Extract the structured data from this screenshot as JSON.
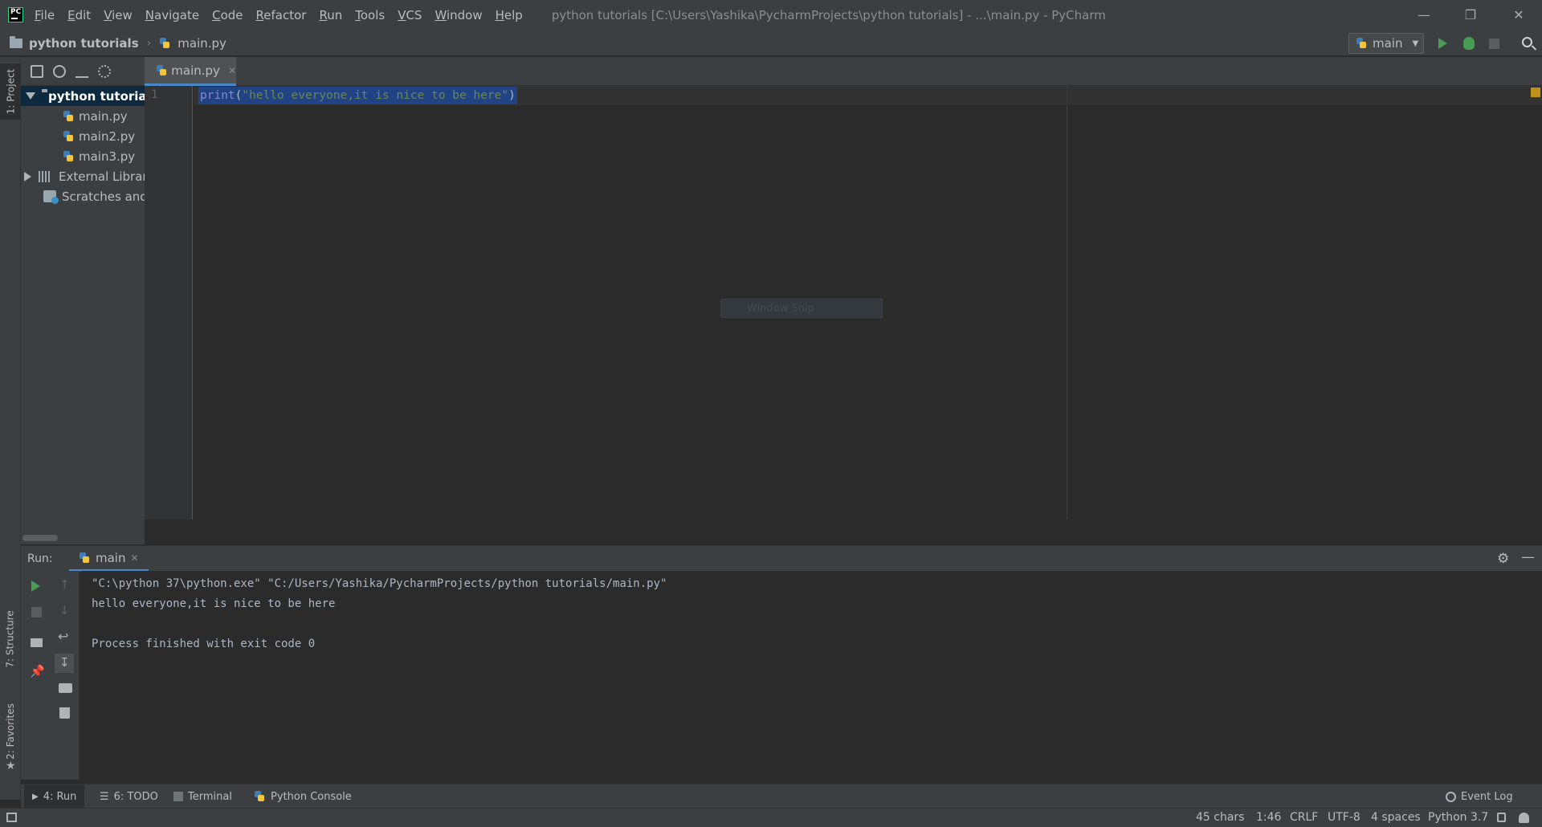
{
  "menu": [
    "File",
    "Edit",
    "View",
    "Navigate",
    "Code",
    "Refactor",
    "Run",
    "Tools",
    "VCS",
    "Window",
    "Help"
  ],
  "window_title": "python tutorials [C:\\Users\\Yashika\\PycharmProjects\\python tutorials] - ...\\main.py - PyCharm",
  "breadcrumb": {
    "project": "python tutorials",
    "file": "main.py"
  },
  "run_config": {
    "name": "main"
  },
  "side_tabs": {
    "project": "1: Project",
    "structure": "7: Structure",
    "favorites": "2: Favorites"
  },
  "project_tree": {
    "root": "python tutorial",
    "files": [
      "main.py",
      "main2.py",
      "main3.py"
    ],
    "external_libraries": "External Librarie",
    "scratches": "Scratches and C"
  },
  "editor": {
    "tab": "main.py",
    "line_number": "1",
    "code": {
      "fn": "print",
      "open": "(",
      "string": "\"hello everyone,it is nice to be here\"",
      "close": ")"
    }
  },
  "overlay_text": "Window Snip",
  "run_panel": {
    "label": "Run:",
    "tab": "main",
    "console": [
      "\"C:\\python 37\\python.exe\" \"C:/Users/Yashika/PycharmProjects/python tutorials/main.py\"",
      "hello everyone,it is nice to be here",
      "",
      "Process finished with exit code 0"
    ]
  },
  "bottom_tools": {
    "run": "4: Run",
    "todo": "6: TODO",
    "terminal": "Terminal",
    "python_console": "Python Console",
    "event_log": "Event Log"
  },
  "status": {
    "chars": "45 chars",
    "position": "1:46",
    "line_sep": "CRLF",
    "encoding": "UTF-8",
    "indent": "4 spaces",
    "interpreter": "Python 3.7"
  },
  "colors": {
    "accent": "#4a88c7",
    "run_green": "#499c54",
    "selection": "#214283",
    "bg": "#2b2b2b",
    "panel": "#3c3f41"
  }
}
